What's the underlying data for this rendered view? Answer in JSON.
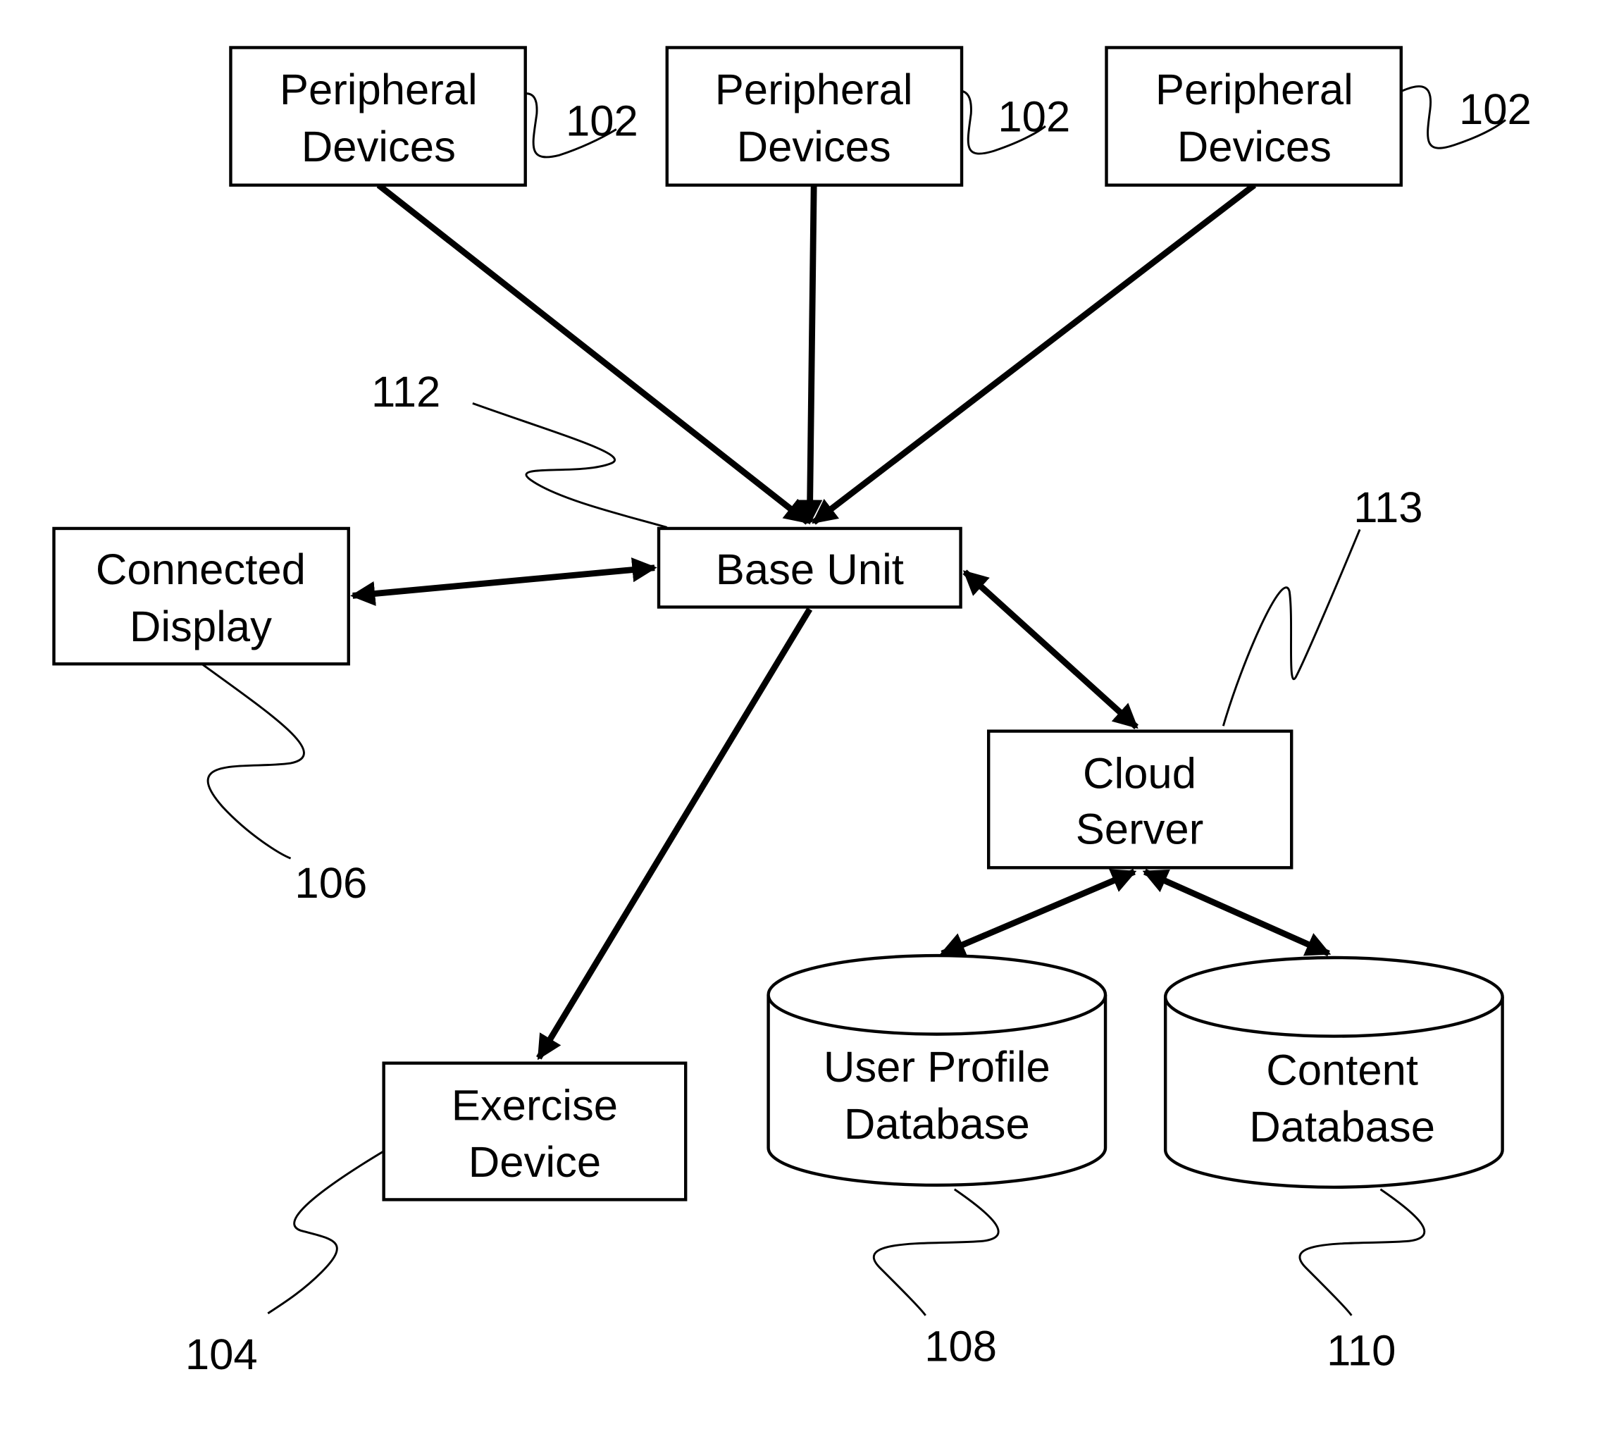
{
  "diagram": {
    "nodes": {
      "peripheral_1": {
        "lines": [
          "Peripheral",
          "Devices"
        ],
        "ref": "102"
      },
      "peripheral_2": {
        "lines": [
          "Peripheral",
          "Devices"
        ],
        "ref": "102"
      },
      "peripheral_3": {
        "lines": [
          "Peripheral",
          "Devices"
        ],
        "ref": "102"
      },
      "base_unit": {
        "lines": [
          "Base Unit"
        ],
        "ref": "112"
      },
      "connected_display": {
        "lines": [
          "Connected",
          "Display"
        ],
        "ref": "106"
      },
      "cloud_server": {
        "lines": [
          "Cloud",
          "Server"
        ],
        "ref": "113"
      },
      "exercise_device": {
        "lines": [
          "Exercise",
          "Device"
        ],
        "ref": "104"
      },
      "user_profile_db": {
        "lines": [
          "User Profile",
          "Database"
        ],
        "ref": "108"
      },
      "content_db": {
        "lines": [
          "Content",
          "Database"
        ],
        "ref": "110"
      }
    },
    "edges": [
      {
        "from": "peripheral_1",
        "to": "base_unit",
        "direction": "forward"
      },
      {
        "from": "peripheral_2",
        "to": "base_unit",
        "direction": "forward"
      },
      {
        "from": "peripheral_3",
        "to": "base_unit",
        "direction": "forward"
      },
      {
        "from": "base_unit",
        "to": "connected_display",
        "direction": "both"
      },
      {
        "from": "base_unit",
        "to": "cloud_server",
        "direction": "both"
      },
      {
        "from": "base_unit",
        "to": "exercise_device",
        "direction": "forward"
      },
      {
        "from": "cloud_server",
        "to": "user_profile_db",
        "direction": "both"
      },
      {
        "from": "cloud_server",
        "to": "content_db",
        "direction": "both"
      }
    ]
  }
}
